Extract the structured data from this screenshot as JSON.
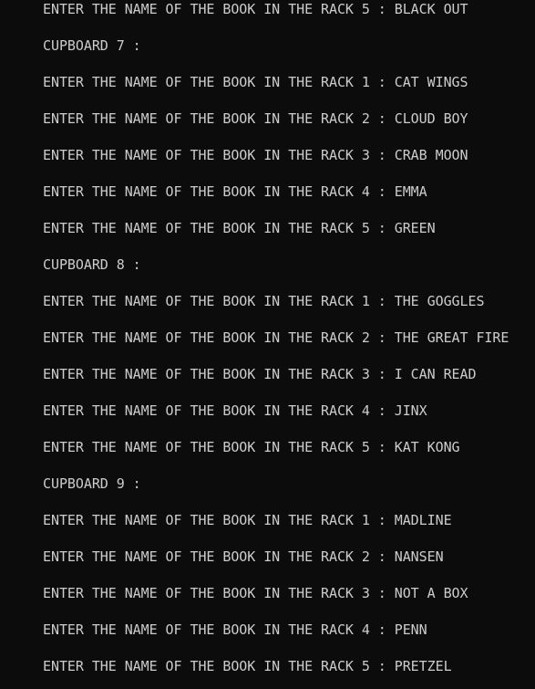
{
  "console": {
    "lines": [
      "ENTER THE NAME OF THE BOOK IN THE RACK 5 : BLACK OUT",
      "CUPBOARD 7 :",
      "ENTER THE NAME OF THE BOOK IN THE RACK 1 : CAT WINGS",
      "ENTER THE NAME OF THE BOOK IN THE RACK 2 : CLOUD BOY",
      "ENTER THE NAME OF THE BOOK IN THE RACK 3 : CRAB MOON",
      "ENTER THE NAME OF THE BOOK IN THE RACK 4 : EMMA",
      "ENTER THE NAME OF THE BOOK IN THE RACK 5 : GREEN",
      "CUPBOARD 8 :",
      "ENTER THE NAME OF THE BOOK IN THE RACK 1 : THE GOGGLES",
      "ENTER THE NAME OF THE BOOK IN THE RACK 2 : THE GREAT FIRE",
      "ENTER THE NAME OF THE BOOK IN THE RACK 3 : I CAN READ",
      "ENTER THE NAME OF THE BOOK IN THE RACK 4 : JINX",
      "ENTER THE NAME OF THE BOOK IN THE RACK 5 : KAT KONG",
      "CUPBOARD 9 :",
      "ENTER THE NAME OF THE BOOK IN THE RACK 1 : MADLINE",
      "ENTER THE NAME OF THE BOOK IN THE RACK 2 : NANSEN",
      "ENTER THE NAME OF THE BOOK IN THE RACK 3 : NOT A BOX",
      "ENTER THE NAME OF THE BOOK IN THE RACK 4 : PENN",
      "ENTER THE NAME OF THE BOOK IN THE RACK 5 : PRETZEL"
    ]
  },
  "colors": {
    "background": "#0c0c0c",
    "text": "#cccccc"
  }
}
